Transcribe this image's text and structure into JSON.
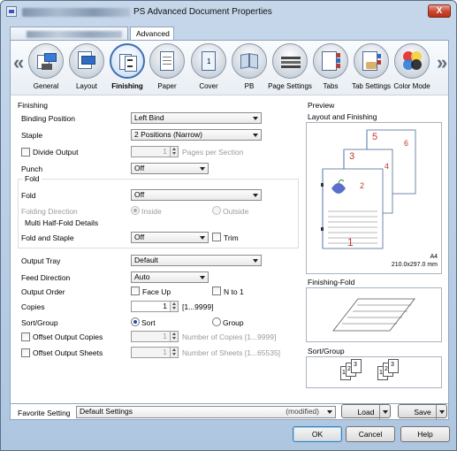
{
  "window": {
    "title": "PS Advanced Document Properties",
    "close_glyph": "X"
  },
  "tabs": [
    {
      "label": "",
      "blurred": true
    },
    {
      "label": "Advanced"
    }
  ],
  "icon_bar": {
    "left_arrow": "«",
    "right_arrow": "»",
    "items": [
      {
        "label": "General",
        "icon": "general-icon"
      },
      {
        "label": "Layout",
        "icon": "layout-icon"
      },
      {
        "label": "Finishing",
        "icon": "finishing-icon",
        "selected": true
      },
      {
        "label": "Paper",
        "icon": "paper-icon"
      },
      {
        "label": "Cover",
        "icon": "cover-icon"
      },
      {
        "label": "PB",
        "icon": "pb-icon"
      },
      {
        "label": "Page Settings",
        "icon": "page-settings-icon"
      },
      {
        "label": "Tabs",
        "icon": "tabs-icon"
      },
      {
        "label": "Tab Settings",
        "icon": "tab-settings-icon"
      },
      {
        "label": "Color Mode",
        "icon": "color-mode-icon"
      }
    ]
  },
  "finishing": {
    "group_title": "Finishing",
    "binding_position": {
      "label": "Binding Position",
      "value": "Left Bind"
    },
    "staple": {
      "label": "Staple",
      "value": "2 Positions (Narrow)"
    },
    "divide_output": {
      "label": "Divide Output",
      "value": "1",
      "unit": "Pages per Section"
    },
    "punch": {
      "label": "Punch",
      "value": "Off"
    },
    "fold_group": "Fold",
    "fold": {
      "label": "Fold",
      "value": "Off"
    },
    "folding_direction": {
      "label": "Folding Direction",
      "option_inside": "Inside",
      "option_outside": "Outside"
    },
    "multi_half_fold": "Multi Half-Fold Details",
    "fold_and_staple": {
      "label": "Fold and Staple",
      "value": "Off",
      "trim_label": "Trim"
    },
    "output_tray": {
      "label": "Output Tray",
      "value": "Default"
    },
    "feed_direction": {
      "label": "Feed Direction",
      "value": "Auto"
    },
    "output_order": {
      "label": "Output Order",
      "face_up": "Face Up",
      "n_to_1": "N to 1"
    },
    "copies": {
      "label": "Copies",
      "value": "1",
      "range": "[1...9999]"
    },
    "sort_group": {
      "label": "Sort/Group",
      "sort": "Sort",
      "group": "Group"
    },
    "offset_output_copies": {
      "label": "Offset Output Copies",
      "value": "1",
      "hint": "Number of Copies [1...9999]"
    },
    "offset_output_sheets": {
      "label": "Offset Output Sheets",
      "value": "1",
      "hint": "Number of Sheets [1...65535]"
    }
  },
  "preview": {
    "title": "Preview",
    "layout_title": "Layout and Finishing",
    "page_numbers": [
      "1",
      "2",
      "3",
      "4",
      "5",
      "6"
    ],
    "paper_size": "A4",
    "paper_dims": "210.0x297.0 mm",
    "finishing_fold_title": "Finishing-Fold",
    "sort_group_title": "Sort/Group",
    "sort_stack_numbers": [
      "1",
      "2",
      "3"
    ]
  },
  "favorite": {
    "label": "Favorite Setting",
    "value": "Default Settings",
    "status": "(modified)",
    "load": "Load",
    "save": "Save"
  },
  "buttons": {
    "ok": "OK",
    "cancel": "Cancel",
    "help": "Help"
  },
  "colors": {
    "accent": "#3d6fb4",
    "page_number_red": "#c0392b",
    "flower_blue": "#5b6fc9"
  }
}
